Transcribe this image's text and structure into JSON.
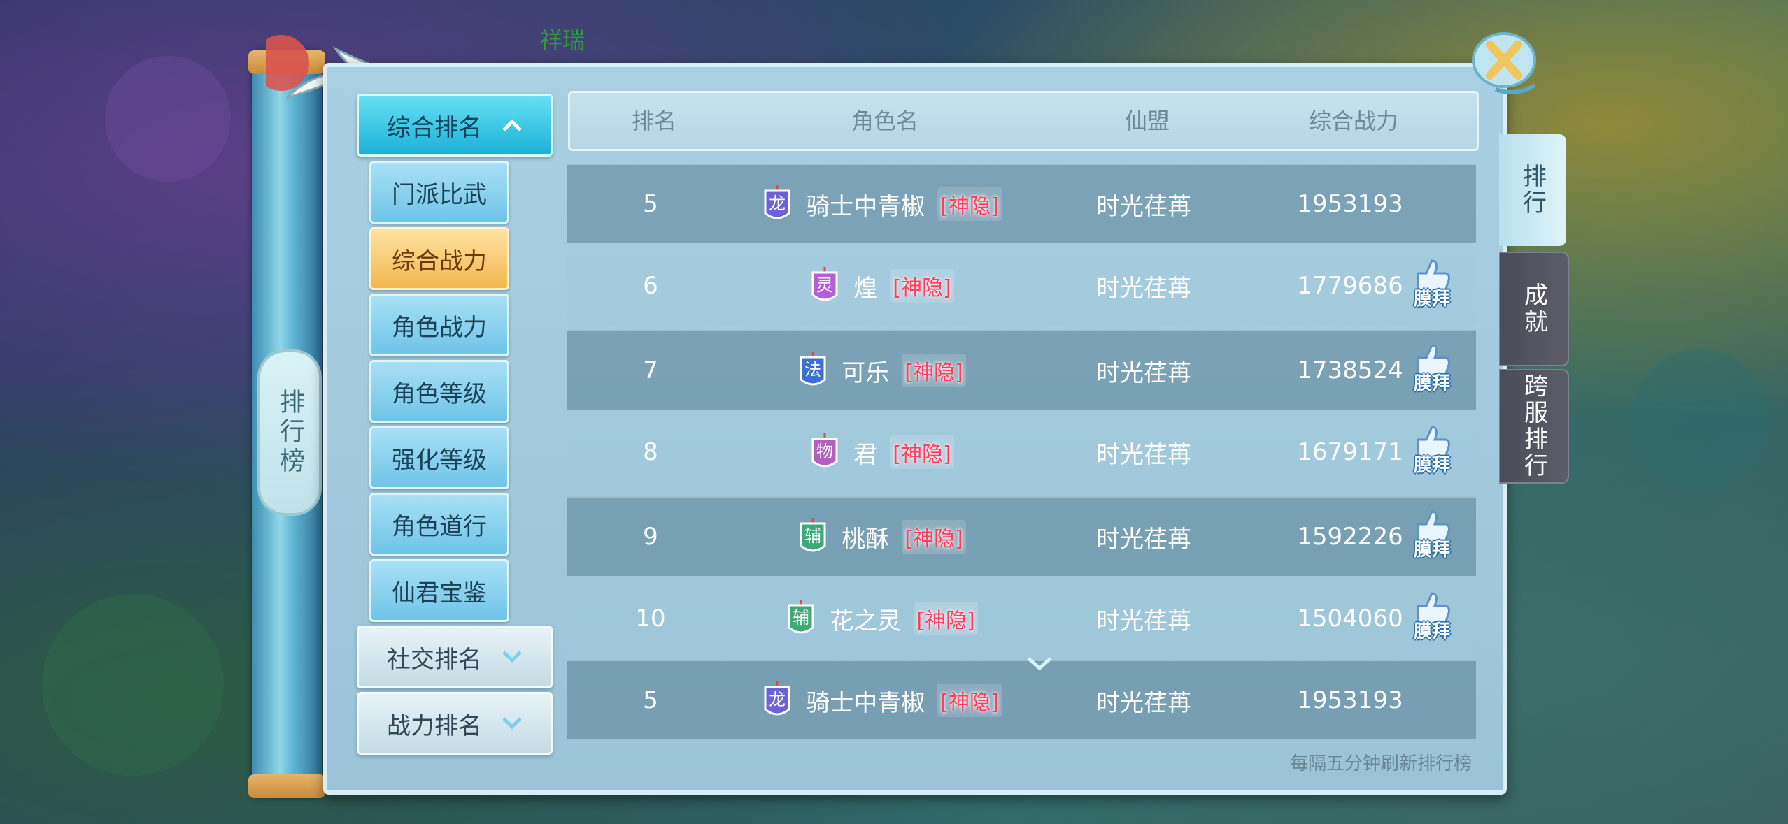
{
  "background": {
    "top_text": "祥瑞"
  },
  "scroll": {
    "tag_label": "排行榜"
  },
  "menu": {
    "group_main": "综合排名",
    "sub_items": [
      "门派比武",
      "综合战力",
      "角色战力",
      "角色等级",
      "强化等级",
      "角色道行",
      "仙君宝鉴"
    ],
    "active_sub": "综合战力",
    "group_social": "社交排名",
    "group_power": "战力排名"
  },
  "table": {
    "headers": {
      "rank": "排名",
      "name": "角色名",
      "league": "仙盟",
      "power": "综合战力"
    },
    "rows": [
      {
        "rank": "5",
        "badge": "龙",
        "badge_color": "#6b62d8",
        "name": "骑士中青椒",
        "tag": "[神隐]",
        "league": "时光荏苒",
        "power": "1953193",
        "worship": ""
      },
      {
        "rank": "6",
        "badge": "灵",
        "badge_color": "#b35fd6",
        "name": "煌",
        "tag": "[神隐]",
        "league": "时光荏苒",
        "power": "1779686",
        "worship": "膜拜"
      },
      {
        "rank": "7",
        "badge": "法",
        "badge_color": "#3d6fd0",
        "name": "可乐",
        "tag": "[神隐]",
        "league": "时光荏苒",
        "power": "1738524",
        "worship": "膜拜"
      },
      {
        "rank": "8",
        "badge": "物",
        "badge_color": "#b35fc0",
        "name": "君",
        "tag": "[神隐]",
        "league": "时光荏苒",
        "power": "1679171",
        "worship": "膜拜"
      },
      {
        "rank": "9",
        "badge": "辅",
        "badge_color": "#3fa878",
        "name": "桃酥",
        "tag": "[神隐]",
        "league": "时光荏苒",
        "power": "1592226",
        "worship": "膜拜"
      },
      {
        "rank": "10",
        "badge": "辅",
        "badge_color": "#3fa878",
        "name": "花之灵",
        "tag": "[神隐]",
        "league": "时光荏苒",
        "power": "1504060",
        "worship": "膜拜"
      }
    ],
    "my_row": {
      "rank": "5",
      "badge": "龙",
      "badge_color": "#6b62d8",
      "name": "骑士中青椒",
      "tag": "[神隐]",
      "league": "时光荏苒",
      "power": "1953193"
    },
    "footer_note": "每隔五分钟刷新排行榜"
  },
  "right_tabs": [
    {
      "label": "排行",
      "active": true
    },
    {
      "label": "成就",
      "active": false
    },
    {
      "label": "跨服排行",
      "active": false
    }
  ]
}
